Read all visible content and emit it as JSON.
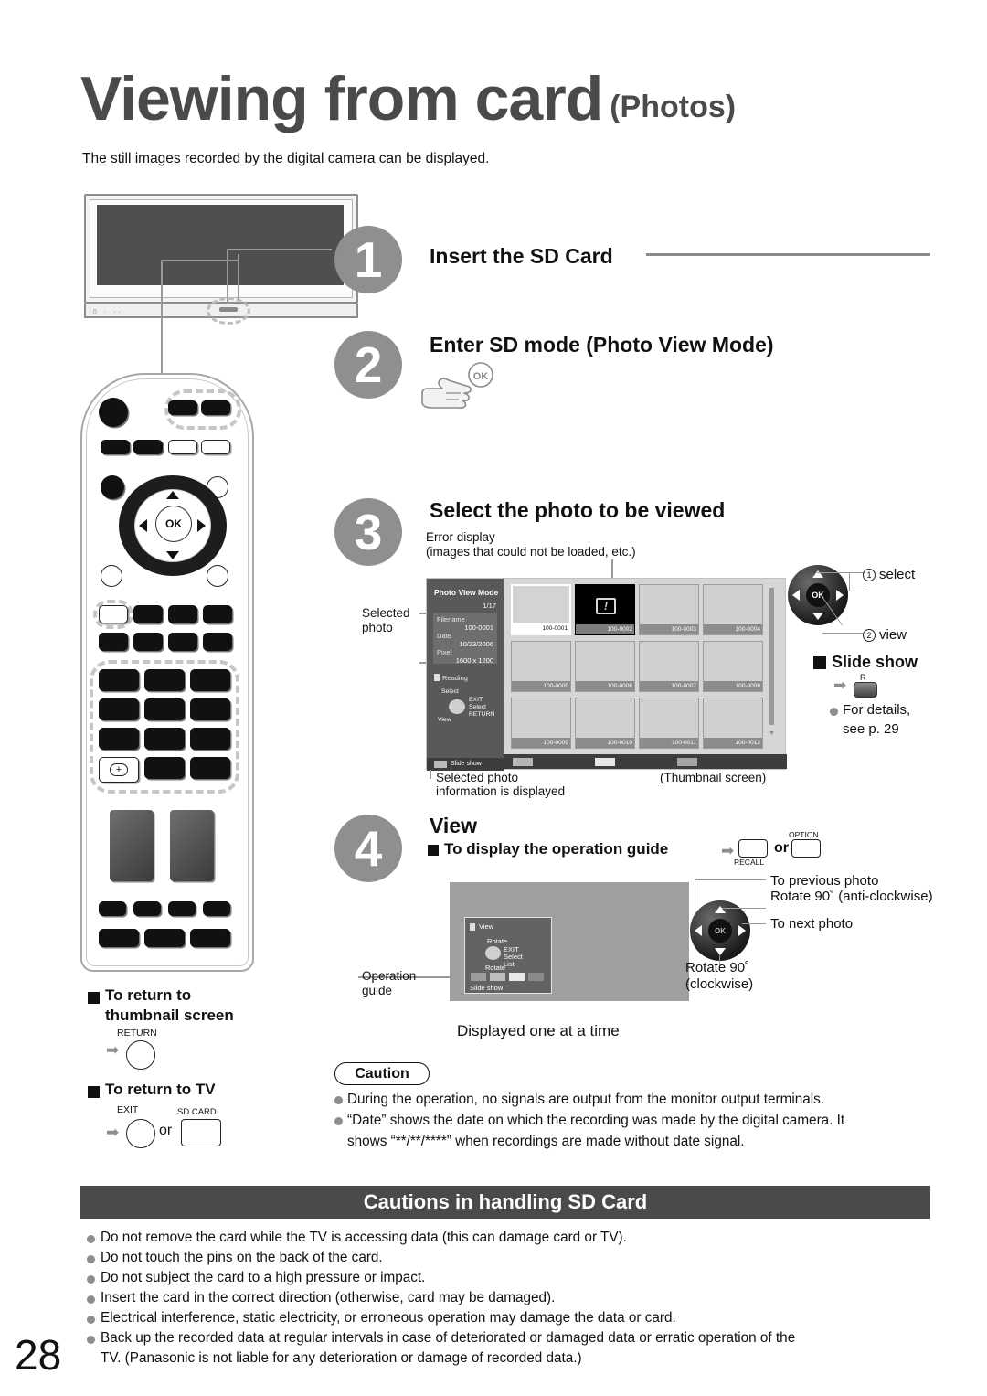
{
  "page": {
    "title_main": "Viewing from card",
    "title_sub": "(Photos)",
    "intro": "The still images recorded by the digital camera can be displayed.",
    "number": "28"
  },
  "steps": [
    {
      "num": "1",
      "heading": "Insert the SD Card"
    },
    {
      "num": "2",
      "heading": "Enter SD mode (Photo View Mode)",
      "ok_icon": "OK"
    },
    {
      "num": "3",
      "heading": "Select the photo to be viewed"
    },
    {
      "num": "4",
      "heading": "View"
    }
  ],
  "step3": {
    "error_caption_line1": "Error display",
    "error_caption_line2": "(images that could not be loaded, etc.)",
    "selected_photo_label_line1": "Selected",
    "selected_photo_label_line2": "photo",
    "below_left_line1": "Selected photo",
    "below_left_line2": "information is displayed",
    "below_right": "(Thumbnail screen)",
    "screen": {
      "mode_title": "Photo View Mode",
      "counter": "1/17",
      "info": [
        {
          "label": "Filename",
          "value": "100-0001"
        },
        {
          "label": "Date",
          "value": "10/23/2006"
        },
        {
          "label": "Pixel",
          "value": "1600 x 1200"
        }
      ],
      "reading": "Reading",
      "guide": {
        "top": "Select",
        "bottom": "View",
        "right": [
          "EXIT",
          "Select",
          "RETURN"
        ]
      },
      "slide_show": "Slide show",
      "thumbnails": [
        "100-0001",
        "100-0002",
        "100-0003",
        "100-0004",
        "100-0005",
        "100-0006",
        "100-0007",
        "100-0008",
        "100-0009",
        "100-0010",
        "100-0011",
        "100-0012"
      ],
      "selected_index": 0,
      "error_index": 1
    },
    "dpad": {
      "ok": "OK",
      "callout1_num": "1",
      "callout1_text": "select",
      "callout2_num": "2",
      "callout2_text": "view"
    },
    "slideshow": {
      "heading": "Slide show",
      "key_label": "R",
      "detail_line1": "For details,",
      "detail_line2": "see p.  29"
    }
  },
  "step4": {
    "opguide_heading": "To display the operation guide",
    "key_recall": "RECALL",
    "or": "or",
    "key_option": "OPTION",
    "operation_guide_label_line1": "Operation",
    "operation_guide_label_line2": "guide",
    "displayed_one": "Displayed one at a time",
    "screen": {
      "title": "View",
      "rotate_top": "Rotate",
      "rotate_bottom": "Rotate",
      "right": [
        "EXIT",
        "Select",
        "List"
      ],
      "slide_show": "Slide show"
    },
    "dpad": {
      "ok": "OK",
      "prev": "To previous photo",
      "rotate_anti": "Rotate 90˚ (anti-clockwise)",
      "next": "To next photo",
      "rotate_cw_line1": "Rotate 90˚",
      "rotate_cw_line2": "(clockwise)"
    }
  },
  "left_notes": {
    "return_thumb_line1": "To return to",
    "return_thumb_line2": "thumbnail screen",
    "return_key": "RETURN",
    "return_tv": "To return to TV",
    "exit_key": "EXIT",
    "or": "or",
    "sdcard_key": "SD CARD"
  },
  "caution": {
    "title": "Caution",
    "items": [
      "During the operation, no signals are output from the monitor output terminals.",
      "“Date” shows the date on which the recording was made by the digital camera. It",
      "shows “**/**/****” when recordings are made without date signal."
    ]
  },
  "sd_cautions": {
    "title": "Cautions in handling SD Card",
    "items": [
      "Do not remove the card while the TV is accessing data (this can damage card or TV).",
      "Do not touch the pins on the back of the card.",
      "Do not subject the card to a high pressure or impact.",
      "Insert the card in the correct direction (otherwise, card may be damaged).",
      "Electrical interference, static electricity, or erroneous operation may damage the data or card.",
      "Back up the recorded data at regular intervals in case of deteriorated or damaged data or erratic operation of the",
      "TV. (Panasonic is not liable for any deterioration or damage of recorded data.)"
    ]
  },
  "colors": {
    "step_circle": "#8f8f8f",
    "header_text": "#4a4a4a",
    "bar_bg": "#4a4a4a",
    "screen_side": "#595959"
  }
}
